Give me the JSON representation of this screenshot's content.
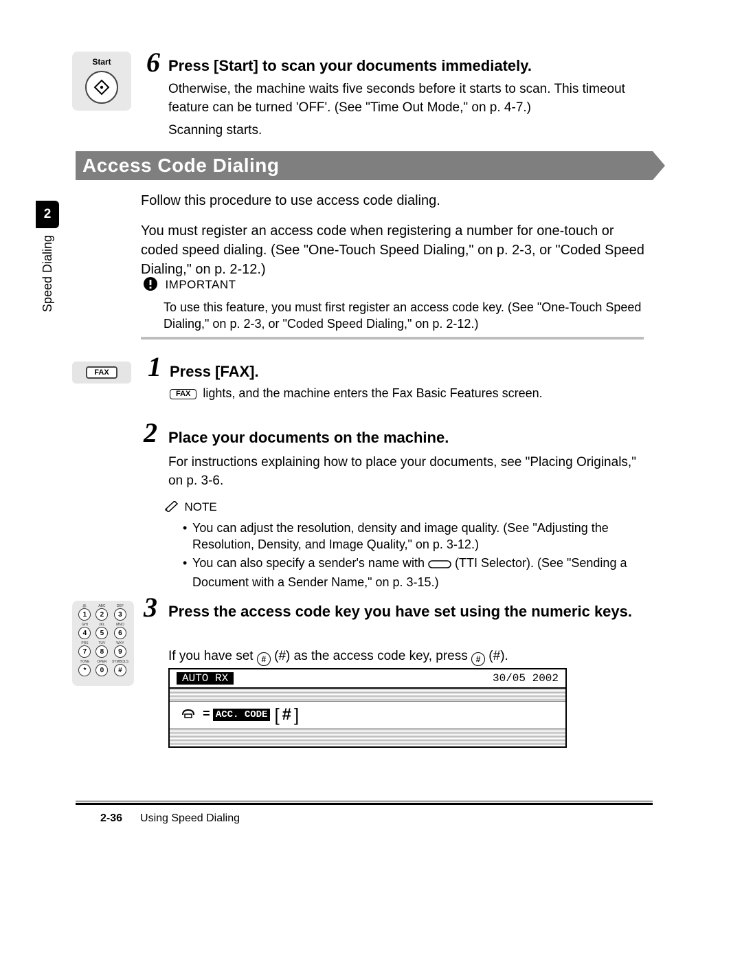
{
  "sidebar": {
    "chapter_number": "2",
    "label": "Speed Dialing"
  },
  "step6": {
    "number": "6",
    "key_label": "Start",
    "heading": "Press [Start] to scan your documents immediately.",
    "body": "Otherwise, the machine waits five seconds before it starts to scan. This timeout feature can be turned 'OFF'. (See \"Time Out Mode,\" on p. 4-7.)",
    "body2": "Scanning starts."
  },
  "section": {
    "title": "Access Code Dialing"
  },
  "intro": {
    "p1": "Follow this procedure to use access code dialing.",
    "p2": "You must register an access code when registering a number for one-touch or coded speed dialing. (See \"One-Touch Speed Dialing,\" on p. 2-3, or \"Coded Speed Dialing,\" on p. 2-12.)"
  },
  "important": {
    "label": "IMPORTANT",
    "body": "To use this feature, you must first register an access code key. (See \"One-Touch Speed Dialing,\" on p. 2-3, or \"Coded Speed Dialing,\" on p. 2-12.)"
  },
  "step1": {
    "number": "1",
    "key_label": "FAX",
    "heading": "Press [FAX].",
    "inline_pill": "FAX",
    "body_after": " lights, and the machine enters the Fax Basic Features screen."
  },
  "step2": {
    "number": "2",
    "heading": "Place your documents on the machine.",
    "body": "For instructions explaining how to place your documents, see \"Placing Originals,\" on p. 3-6.",
    "note_label": "NOTE",
    "note_items": [
      "You can adjust the resolution, density and image quality. (See \"Adjusting the Resolution, Density, and Image Quality,\" on p. 3-12.)",
      {
        "pre": "You can also specify a sender's name with ",
        "post": " (TTI Selector). (See \"Sending a Document with a Sender Name,\" on p. 3-15.)"
      }
    ]
  },
  "step3": {
    "number": "3",
    "heading": "Press the access code key you have set using the numeric keys.",
    "body_pre": "If you have set ",
    "body_mid1": " (#) as the access code key, press ",
    "body_post": " (#).",
    "numpad_labels": [
      {
        "tiny": "@.",
        "d": "1"
      },
      {
        "tiny": "ABC",
        "d": "2"
      },
      {
        "tiny": "DEF",
        "d": "3"
      },
      {
        "tiny": "GHI",
        "d": "4"
      },
      {
        "tiny": "JKL",
        "d": "5"
      },
      {
        "tiny": "MNO",
        "d": "6"
      },
      {
        "tiny": "PRS",
        "d": "7"
      },
      {
        "tiny": "TUV",
        "d": "8"
      },
      {
        "tiny": "WXY",
        "d": "9"
      },
      {
        "tiny": "TONE",
        "d": "*"
      },
      {
        "tiny": "OPER",
        "d": "0"
      },
      {
        "tiny": "SYMBOLS",
        "d": "#"
      }
    ],
    "lcd": {
      "mode": "AUTO RX",
      "date": "30/05 2002",
      "line2_prefix": "=",
      "line2_rev": "ACC. CODE",
      "line2_hash": "#"
    }
  },
  "footer": {
    "page": "2-36",
    "title": "Using Speed Dialing"
  }
}
